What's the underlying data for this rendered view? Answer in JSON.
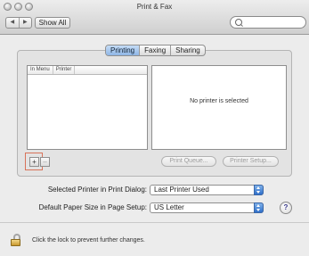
{
  "window": {
    "title": "Print & Fax"
  },
  "toolbar": {
    "back_glyph": "◀",
    "forward_glyph": "▶",
    "show_all_label": "Show All",
    "search_placeholder": ""
  },
  "tabs": [
    {
      "label": "Printing",
      "active": true
    },
    {
      "label": "Faxing",
      "active": false
    },
    {
      "label": "Sharing",
      "active": false
    }
  ],
  "printer_list": {
    "columns": [
      "In Menu",
      "Printer"
    ],
    "empty_detail": "No printer is selected"
  },
  "list_buttons": {
    "add": "+",
    "remove": "–"
  },
  "actions": {
    "print_queue": "Print Queue...",
    "printer_setup": "Printer Setup..."
  },
  "settings": {
    "selected_printer_label": "Selected Printer in Print Dialog:",
    "selected_printer_value": "Last Printer Used",
    "paper_size_label": "Default Paper Size in Page Setup:",
    "paper_size_value": "US Letter"
  },
  "help": {
    "glyph": "?"
  },
  "lock": {
    "text": "Click the lock to prevent further changes."
  },
  "icons": {
    "close": "close-icon",
    "minimize": "minimize-icon",
    "zoom": "zoom-icon",
    "search": "search-icon",
    "lock": "lock-icon"
  },
  "colors": {
    "active_tab": "#8fb6e6",
    "highlight_box": "#d8735a",
    "popup_arrows": "#2e6ec9"
  }
}
